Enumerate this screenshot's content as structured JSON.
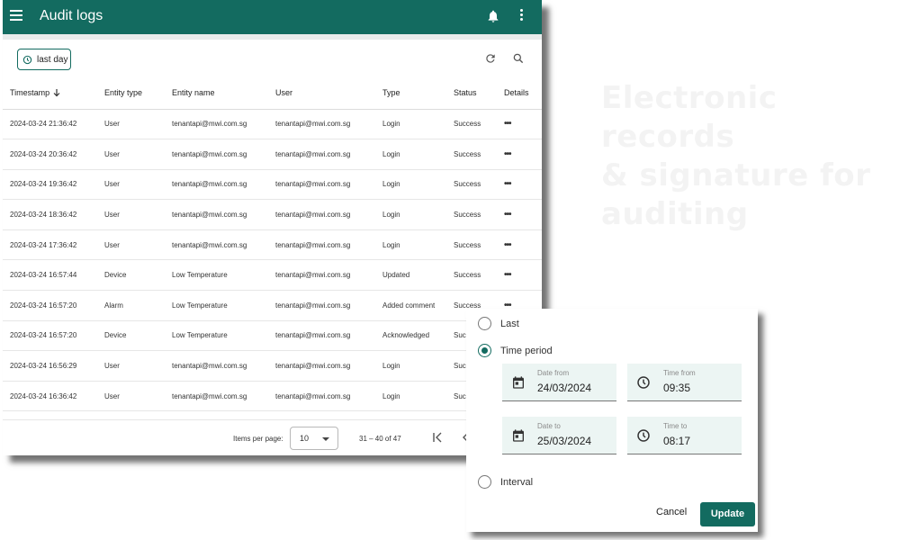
{
  "headline": {
    "line1": "Electronic records",
    "line2": "& signature for",
    "line3": "auditing"
  },
  "app": {
    "title": "Audit logs",
    "brand_color": "#136b60"
  },
  "toolbar": {
    "time_chip_label": "last day"
  },
  "table": {
    "columns": {
      "timestamp": "Timestamp",
      "entity_type": "Entity type",
      "entity_name": "Entity name",
      "user": "User",
      "type": "Type",
      "status": "Status",
      "details": "Details"
    },
    "details_icon": "•••",
    "rows": [
      {
        "timestamp": "2024-03-24 21:36:42",
        "entity_type": "User",
        "entity_name": "tenantapi@mwi.com.sg",
        "user": "tenantapi@mwi.com.sg",
        "type": "Login",
        "status": "Success"
      },
      {
        "timestamp": "2024-03-24 20:36:42",
        "entity_type": "User",
        "entity_name": "tenantapi@mwi.com.sg",
        "user": "tenantapi@mwi.com.sg",
        "type": "Login",
        "status": "Success"
      },
      {
        "timestamp": "2024-03-24 19:36:42",
        "entity_type": "User",
        "entity_name": "tenantapi@mwi.com.sg",
        "user": "tenantapi@mwi.com.sg",
        "type": "Login",
        "status": "Success"
      },
      {
        "timestamp": "2024-03-24 18:36:42",
        "entity_type": "User",
        "entity_name": "tenantapi@mwi.com.sg",
        "user": "tenantapi@mwi.com.sg",
        "type": "Login",
        "status": "Success"
      },
      {
        "timestamp": "2024-03-24 17:36:42",
        "entity_type": "User",
        "entity_name": "tenantapi@mwi.com.sg",
        "user": "tenantapi@mwi.com.sg",
        "type": "Login",
        "status": "Success"
      },
      {
        "timestamp": "2024-03-24 16:57:44",
        "entity_type": "Device",
        "entity_name": "Low Temperature",
        "user": "tenantapi@mwi.com.sg",
        "type": "Updated",
        "status": "Success"
      },
      {
        "timestamp": "2024-03-24 16:57:20",
        "entity_type": "Alarm",
        "entity_name": "Low Temperature",
        "user": "tenantapi@mwi.com.sg",
        "type": "Added comment",
        "status": "Success"
      },
      {
        "timestamp": "2024-03-24 16:57:20",
        "entity_type": "Device",
        "entity_name": "Low Temperature",
        "user": "tenantapi@mwi.com.sg",
        "type": "Acknowledged",
        "status": "Success"
      },
      {
        "timestamp": "2024-03-24 16:56:29",
        "entity_type": "User",
        "entity_name": "tenantapi@mwi.com.sg",
        "user": "tenantapi@mwi.com.sg",
        "type": "Login",
        "status": "Success"
      },
      {
        "timestamp": "2024-03-24 16:36:42",
        "entity_type": "User",
        "entity_name": "tenantapi@mwi.com.sg",
        "user": "tenantapi@mwi.com.sg",
        "type": "Login",
        "status": "Success"
      }
    ]
  },
  "paginator": {
    "items_per_page_label": "Items per page:",
    "items_per_page_value": "10",
    "range_label": "31 – 40 of 47"
  },
  "popup": {
    "option_last": "Last",
    "option_time_period": "Time period",
    "option_interval": "Interval",
    "selected_option": "Time period",
    "date_from_label": "Date from",
    "date_from_value": "24/03/2024",
    "time_from_label": "Time from",
    "time_from_value": "09:35",
    "date_to_label": "Date to",
    "date_to_value": "25/03/2024",
    "time_to_label": "Time to",
    "time_to_value": "08:17",
    "cancel_label": "Cancel",
    "update_label": "Update"
  }
}
